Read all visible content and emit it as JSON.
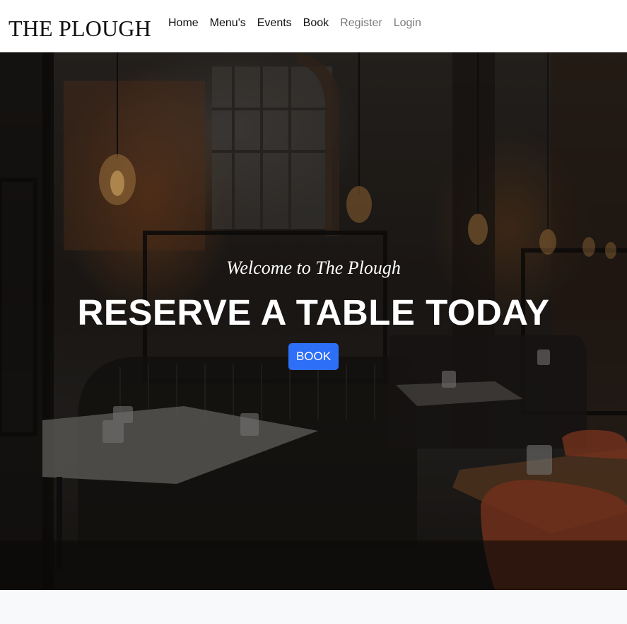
{
  "navbar": {
    "brand": "THE PLOUGH",
    "links": [
      {
        "label": "Home"
      },
      {
        "label": "Menu's"
      },
      {
        "label": "Events"
      },
      {
        "label": "Book"
      },
      {
        "label": "Register"
      },
      {
        "label": "Login"
      }
    ]
  },
  "hero": {
    "welcome": "Welcome to The Plough",
    "headline": "RESERVE A TABLE TODAY",
    "button_label": "BOOK"
  },
  "colors": {
    "button": "#2d6ff6",
    "nav_muted": "#7a7a7a"
  }
}
